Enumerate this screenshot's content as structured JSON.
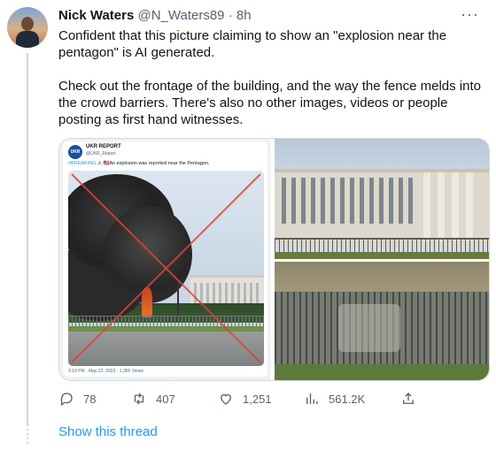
{
  "tweet": {
    "display_name": "Nick Waters",
    "handle": "@N_Waters89",
    "separator": "·",
    "time": "8h",
    "more_icon": "more-horizontal-icon",
    "text_1": "Confident that this picture claiming to show an \"explosion near the pentagon\" is AI generated.",
    "text_2": "Check out the frontage of the building, and the way the fence melds into the crowd barriers. There's also no other images, videos or people posting as first hand witnesses."
  },
  "media": {
    "screenshot": {
      "logo": "UKR",
      "account_name": "UKR REPORT",
      "account_handle": "@UKR_Report",
      "breaking_tag": "#BREAKING",
      "breaking_text": "⚠ 🇺🇸An explosion was reported near the Pentagon.",
      "footer": "3:10 PM · May 22, 2023 · 1,366 Views"
    }
  },
  "actions": {
    "replies": "78",
    "retweets": "407",
    "likes": "1,251",
    "views": "561.2K",
    "icons": [
      "reply-icon",
      "retweet-icon",
      "like-icon",
      "views-icon",
      "share-icon"
    ]
  },
  "show_thread": "Show this thread",
  "colors": {
    "link": "#1d9bf0",
    "muted": "#536471",
    "text": "#0f1419",
    "x_mark": "#e0413a"
  }
}
